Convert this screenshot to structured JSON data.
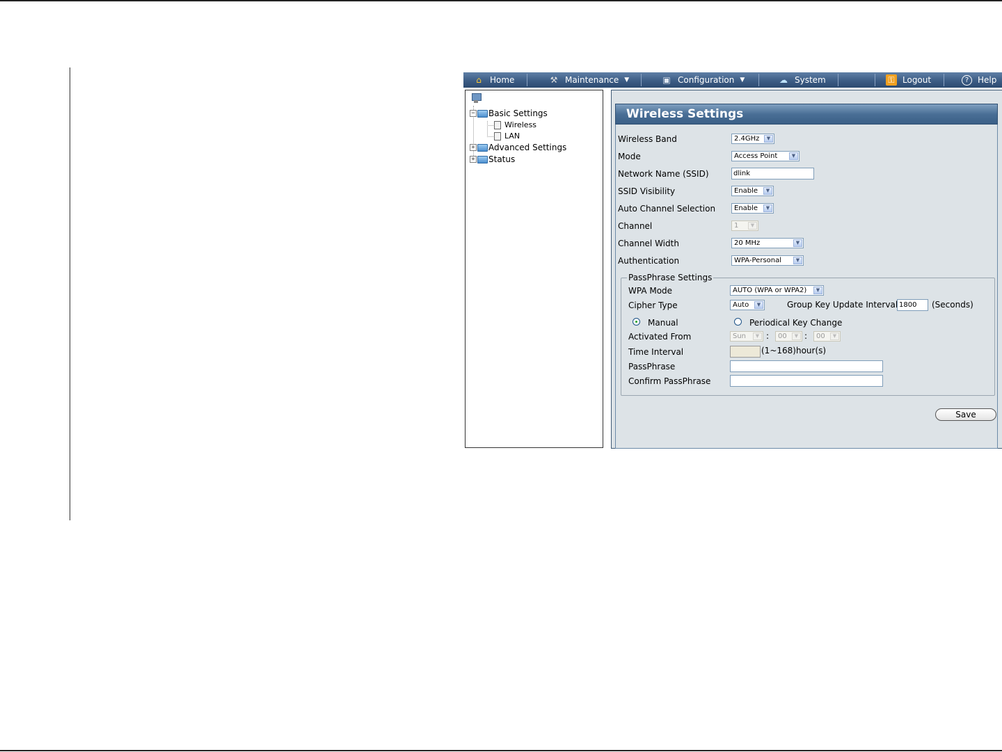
{
  "menu": {
    "home": "Home",
    "maintenance": "Maintenance",
    "configuration": "Configuration",
    "system": "System",
    "logout": "Logout",
    "help": "Help"
  },
  "tree": {
    "basic_settings": "Basic Settings",
    "wireless": "Wireless",
    "lan": "LAN",
    "advanced_settings": "Advanced Settings",
    "status": "Status"
  },
  "panel": {
    "title": "Wireless Settings"
  },
  "form": {
    "wireless_band": {
      "label": "Wireless Band",
      "value": "2.4GHz"
    },
    "mode": {
      "label": "Mode",
      "value": "Access Point"
    },
    "ssid": {
      "label": "Network Name (SSID)",
      "value": "dlink"
    },
    "ssid_visibility": {
      "label": "SSID Visibility",
      "value": "Enable"
    },
    "auto_channel": {
      "label": "Auto Channel Selection",
      "value": "Enable"
    },
    "channel": {
      "label": "Channel",
      "value": "1"
    },
    "channel_width": {
      "label": "Channel Width",
      "value": "20 MHz"
    },
    "authentication": {
      "label": "Authentication",
      "value": "WPA-Personal"
    }
  },
  "passphrase": {
    "legend": "PassPhrase Settings",
    "wpa_mode": {
      "label": "WPA Mode",
      "value": "AUTO (WPA or WPA2)"
    },
    "cipher_type": {
      "label": "Cipher Type",
      "value": "Auto"
    },
    "group_key": {
      "label": "Group Key Update Interval",
      "value": "1800",
      "unit": "(Seconds)"
    },
    "manual_label": "Manual",
    "periodical_label": "Periodical Key Change",
    "activated_from": {
      "label": "Activated From",
      "day": "Sun",
      "hour": "00",
      "minute": "00",
      "sep": ":"
    },
    "time_interval": {
      "label": "Time Interval",
      "value": "",
      "hint": "(1~168)hour(s)"
    },
    "passphrase_label": "PassPhrase",
    "confirm_label": "Confirm PassPhrase"
  },
  "save_label": "Save"
}
